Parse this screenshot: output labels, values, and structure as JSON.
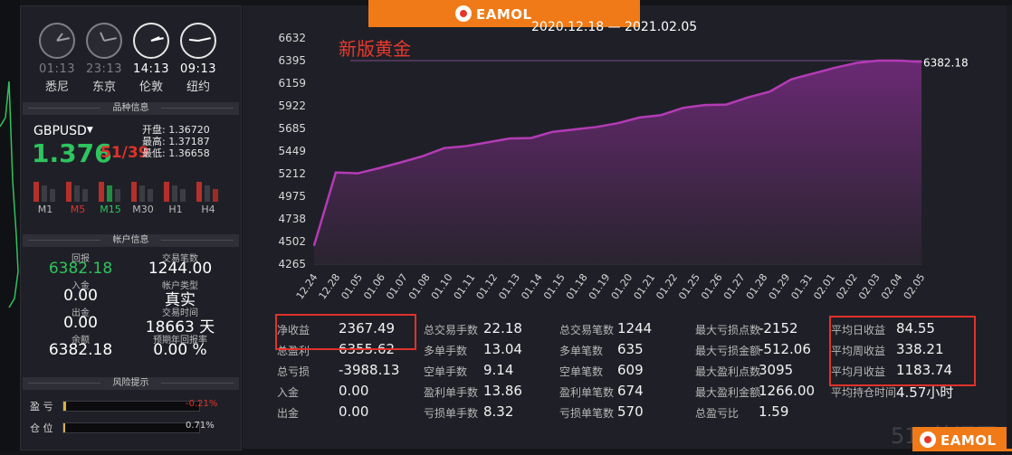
{
  "clocks": [
    {
      "time": "01:13",
      "city": "悉尼",
      "style": "dim",
      "h": 1,
      "m": 13
    },
    {
      "time": "23:13",
      "city": "东京",
      "style": "dim",
      "h": 23,
      "m": 13
    },
    {
      "time": "14:13",
      "city": "伦敦",
      "style": "bright",
      "h": 14,
      "m": 13
    },
    {
      "time": "09:13",
      "city": "纽约",
      "style": "bright",
      "h": 9,
      "m": 13
    }
  ],
  "symbol_section": {
    "title": "品种信息",
    "symbol": "GBPUSD",
    "price": "1.376",
    "price_suffix": "51/39",
    "open": "开盘: 1.36720",
    "high": "最高: 1.37187",
    "low": "最低: 1.36658",
    "timeframes": [
      {
        "label": "M1",
        "color": "#b9b9b9"
      },
      {
        "label": "M5",
        "color": "#e0322a"
      },
      {
        "label": "M15",
        "color": "#2ec45e"
      },
      {
        "label": "M30",
        "color": "#b9b9b9"
      },
      {
        "label": "H1",
        "color": "#b9b9b9"
      },
      {
        "label": "H4",
        "color": "#b9b9b9"
      }
    ]
  },
  "account_section": {
    "title": "帐户信息",
    "items": [
      {
        "label": "回报",
        "value": "6382.18",
        "color": "#2ec45e"
      },
      {
        "label": "交易笔数",
        "value": "1244.00",
        "color": "#ffffff"
      },
      {
        "label": "入金",
        "value": "0.00",
        "color": "#ffffff"
      },
      {
        "label": "帐户类型",
        "value": "真实",
        "color": "#ffffff"
      },
      {
        "label": "出金",
        "value": "0.00",
        "color": "#ffffff"
      },
      {
        "label": "交易时间",
        "value": "18663 天",
        "color": "#ffffff"
      },
      {
        "label": "余额",
        "value": "6382.18",
        "color": "#ffffff"
      },
      {
        "label": "预期年回报率",
        "value": "0.00 %",
        "color": "#ffffff"
      }
    ]
  },
  "risk_section": {
    "title": "风险提示",
    "rows": [
      {
        "label": "盈 亏",
        "value": "-0.21%",
        "color": "#e0322a",
        "fill": 0.02
      },
      {
        "label": "仓 位",
        "value": "0.71%",
        "color": "#d8d8d8",
        "fill": 0.007
      }
    ]
  },
  "banner": {
    "logo": "EAMOL"
  },
  "chart_header": {
    "date_range": "2020.12.18 — 2021.02.05",
    "strategy": "新版黄金"
  },
  "chart_data": {
    "type": "area",
    "y_ticks": [
      "6632",
      "6395",
      "6159",
      "5922",
      "5685",
      "5449",
      "5212",
      "4975",
      "4738",
      "4502",
      "4265"
    ],
    "ylim": [
      4265,
      6632
    ],
    "x": [
      "12.24",
      "12.28",
      "01.05",
      "01.06",
      "01.07",
      "01.08",
      "01.10",
      "01.11",
      "01.12",
      "01.13",
      "01.14",
      "01.15",
      "01.18",
      "01.19",
      "01.20",
      "01.21",
      "01.22",
      "01.25",
      "01.26",
      "01.27",
      "01.28",
      "01.29",
      "01.31",
      "02.01",
      "02.02",
      "02.03",
      "02.04",
      "02.05"
    ],
    "values": [
      4460,
      5225,
      5215,
      5270,
      5330,
      5395,
      5480,
      5500,
      5540,
      5580,
      5585,
      5650,
      5675,
      5700,
      5740,
      5800,
      5825,
      5900,
      5930,
      5935,
      6010,
      6070,
      6200,
      6260,
      6320,
      6370,
      6395,
      6395,
      6382.18
    ],
    "last_value_label": "6382.18",
    "reference_line": 6395,
    "colors": {
      "line": "#b43bb5",
      "fill_top": "#6e2a78",
      "fill_bottom": "#2a2430"
    }
  },
  "stats": {
    "col1": [
      {
        "k": "净收益",
        "v": "2367.49"
      },
      {
        "k": "总盈利",
        "v": "6355.62"
      },
      {
        "k": "总亏损",
        "v": "-3988.13"
      },
      {
        "k": "入金",
        "v": "0.00"
      },
      {
        "k": "出金",
        "v": "0.00"
      }
    ],
    "col2": [
      {
        "k": "总交易手数",
        "v": "22.18"
      },
      {
        "k": "多单手数",
        "v": "13.04"
      },
      {
        "k": "空单手数",
        "v": "9.14"
      },
      {
        "k": "盈利单手数",
        "v": "13.86"
      },
      {
        "k": "亏损单手数",
        "v": "8.32"
      }
    ],
    "col3": [
      {
        "k": "总交易笔数",
        "v": "1244"
      },
      {
        "k": "多单笔数",
        "v": "635"
      },
      {
        "k": "空单笔数",
        "v": "609"
      },
      {
        "k": "盈利单笔数",
        "v": "674"
      },
      {
        "k": "亏损单笔数",
        "v": "570"
      }
    ],
    "col4": [
      {
        "k": "最大亏损点数",
        "v": "-2152"
      },
      {
        "k": "最大亏损金额",
        "v": "-512.06"
      },
      {
        "k": "最大盈利点数",
        "v": "3095"
      },
      {
        "k": "最大盈利金额",
        "v": "1266.00"
      },
      {
        "k": "总盈亏比",
        "v": "1.59"
      }
    ],
    "col5": [
      {
        "k": "平均日收益",
        "v": "84.55"
      },
      {
        "k": "平均周收益",
        "v": "338.21"
      },
      {
        "k": "平均月收益",
        "v": "1183.74"
      },
      {
        "k": "平均持仓时间",
        "v": "4.57小时"
      }
    ]
  },
  "watermark": "518外汇网",
  "footer_logo": "EAMOL"
}
